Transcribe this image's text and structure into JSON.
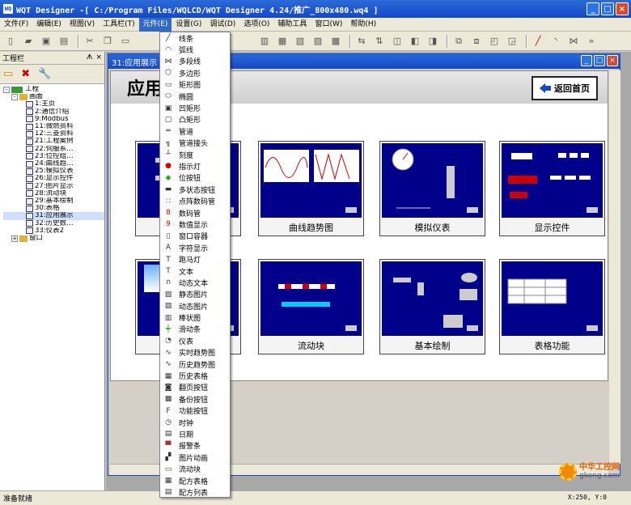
{
  "window": {
    "title": "WQT Designer -[ C:/Program Files/WQLCD/WQT Designer 4.24/推广_800x480.wq4 ]",
    "app_icon": "WQ"
  },
  "menu": [
    "文件(F)",
    "编辑(E)",
    "视图(V)",
    "工具栏(T)",
    "元件(E)",
    "设置(G)",
    "调试(D)",
    "选项(O)",
    "辅助工具",
    "窗口(W)",
    "帮助(H)"
  ],
  "left_panel": {
    "title": "工程栏",
    "root": "工程",
    "group1": "画面",
    "pages": [
      "1:主页",
      "2:通信介绍",
      "9:Modbus",
      "11:微燃资料",
      "12:三菱资料",
      "21:工程案例",
      "22:伺服系…",
      "23:位控组…",
      "24:曲线趋…",
      "25:模拟仪表",
      "26:显示控件",
      "27:图片显示",
      "28:流动块",
      "29:基本绘制",
      "30:表格",
      "31:应用展示",
      "32:历史数…",
      "33:仪表2"
    ],
    "group2": "窗口"
  },
  "child_window": {
    "title": "31:应用展示"
  },
  "canvas": {
    "heading": "应用展示",
    "back_button": "返回首页",
    "cards": [
      {
        "caption": ""
      },
      {
        "caption": "曲线趋势图"
      },
      {
        "caption": "模拟仪表"
      },
      {
        "caption": "显示控件"
      },
      {
        "caption": ""
      },
      {
        "caption": "流动块"
      },
      {
        "caption": "基本绘制"
      },
      {
        "caption": "表格功能"
      }
    ]
  },
  "dropdown": {
    "items": [
      {
        "label": "线条",
        "icon": "line-icon"
      },
      {
        "label": "弧线",
        "icon": "arc-icon"
      },
      {
        "label": "多段线",
        "icon": "polyline-icon"
      },
      {
        "label": "多边形",
        "icon": "polygon-icon"
      },
      {
        "label": "矩形图",
        "icon": "rect-icon"
      },
      {
        "label": "椭圆",
        "icon": "ellipse-icon"
      },
      {
        "label": "凹矩形",
        "icon": "concave-rect-icon"
      },
      {
        "label": "凸矩形",
        "icon": "convex-rect-icon"
      },
      {
        "label": "管道",
        "icon": "pipe-icon"
      },
      {
        "label": "管道接头",
        "icon": "pipe-joint-icon"
      },
      {
        "label": "刻度",
        "icon": "scale-icon"
      },
      {
        "label": "指示灯",
        "icon": "lamp-icon"
      },
      {
        "label": "位按钮",
        "icon": "bit-button-icon"
      },
      {
        "label": "多状态按钮",
        "icon": "multistate-button-icon"
      },
      {
        "label": "点阵数码管",
        "icon": "dot-matrix-icon"
      },
      {
        "label": "数码管",
        "icon": "digit-tube-icon"
      },
      {
        "label": "数值显示",
        "icon": "number-display-icon"
      },
      {
        "label": "窗口容器",
        "icon": "window-container-icon"
      },
      {
        "label": "字符显示",
        "icon": "char-display-icon"
      },
      {
        "label": "跑马灯",
        "icon": "marquee-icon"
      },
      {
        "label": "文本",
        "icon": "text-icon"
      },
      {
        "label": "动态文本",
        "icon": "dynamic-text-icon"
      },
      {
        "label": "静态图片",
        "icon": "static-image-icon"
      },
      {
        "label": "动态图片",
        "icon": "dynamic-image-icon"
      },
      {
        "label": "棒状图",
        "icon": "bar-graph-icon"
      },
      {
        "label": "滑动条",
        "icon": "slider-icon"
      },
      {
        "label": "仪表",
        "icon": "meter-icon"
      },
      {
        "label": "实时趋势图",
        "icon": "realtime-trend-icon"
      },
      {
        "label": "历史趋势图",
        "icon": "history-trend-icon"
      },
      {
        "label": "历史表格",
        "icon": "history-table-icon"
      },
      {
        "label": "翻页按钮",
        "icon": "page-button-icon"
      },
      {
        "label": "备份按钮",
        "icon": "backup-button-icon"
      },
      {
        "label": "功能按钮",
        "icon": "function-button-icon"
      },
      {
        "label": "时钟",
        "icon": "clock-icon"
      },
      {
        "label": "日期",
        "icon": "date-icon"
      },
      {
        "label": "报警条",
        "icon": "alarm-bar-icon"
      },
      {
        "label": "图片动画",
        "icon": "image-animation-icon"
      },
      {
        "label": "流动块",
        "icon": "flow-block-icon"
      },
      {
        "label": "配方表格",
        "icon": "recipe-table-icon"
      },
      {
        "label": "配方列表",
        "icon": "recipe-list-icon"
      }
    ]
  },
  "status": {
    "left": "准备就绪",
    "coord": "X:250, Y:0"
  },
  "watermark": {
    "name": "中华工控网",
    "url": "gkong.com"
  }
}
